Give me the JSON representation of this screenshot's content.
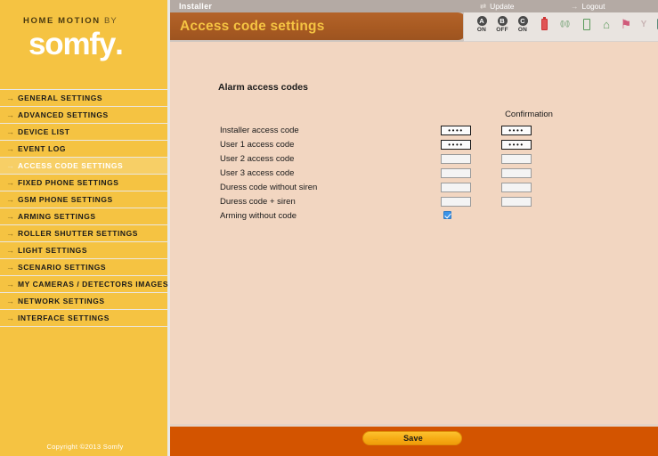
{
  "brand": {
    "tagline_main": "HOME MOTION",
    "tagline_by": "BY",
    "wordmark": "somfy",
    "wordmark_dot": ".",
    "copyright": "Copyright ©2013 Somfy"
  },
  "topbar": {
    "title": "Installer",
    "update_label": "Update",
    "update_icon": "refresh-icon",
    "logout_label": "Logout",
    "logout_icon": "arrow-right-icon"
  },
  "header": {
    "page_title": "Access code settings"
  },
  "status_icons": [
    {
      "name": "zone-a-indicator",
      "badge": "A",
      "label": "ON"
    },
    {
      "name": "zone-b-indicator",
      "badge": "B",
      "label": "OFF"
    },
    {
      "name": "zone-c-indicator",
      "badge": "C",
      "label": "ON"
    },
    {
      "name": "battery-icon"
    },
    {
      "name": "signal-waves-icon",
      "glyph": "))"
    },
    {
      "name": "door-sensor-icon"
    },
    {
      "name": "house-icon",
      "glyph": "⌂"
    },
    {
      "name": "flag-icon",
      "glyph": "⚑"
    },
    {
      "name": "antenna-icon",
      "glyph": "Y"
    },
    {
      "name": "module-icon"
    }
  ],
  "sidebar": {
    "items": [
      {
        "label": "GENERAL SETTINGS",
        "active": false
      },
      {
        "label": "ADVANCED SETTINGS",
        "active": false
      },
      {
        "label": "DEVICE LIST",
        "active": false
      },
      {
        "label": "EVENT LOG",
        "active": false
      },
      {
        "label": "ACCESS CODE SETTINGS",
        "active": true
      },
      {
        "label": "FIXED PHONE SETTINGS",
        "active": false
      },
      {
        "label": "GSM PHONE SETTINGS",
        "active": false
      },
      {
        "label": "ARMING SETTINGS",
        "active": false
      },
      {
        "label": "ROLLER SHUTTER SETTINGS",
        "active": false
      },
      {
        "label": "LIGHT SETTINGS",
        "active": false
      },
      {
        "label": "SCENARIO SETTINGS",
        "active": false
      },
      {
        "label": "MY CAMERAS / DETECTORS IMAGES",
        "active": false
      },
      {
        "label": "NETWORK SETTINGS",
        "active": false
      },
      {
        "label": "INTERFACE SETTINGS",
        "active": false
      }
    ]
  },
  "main": {
    "section_title": "Alarm access codes",
    "confirmation_header": "Confirmation",
    "rows": [
      {
        "label": "Installer access code",
        "type": "code",
        "value": "••••",
        "confirm": "••••",
        "filled": true
      },
      {
        "label": "User 1 access code",
        "type": "code",
        "value": "••••",
        "confirm": "••••",
        "filled": true
      },
      {
        "label": "User 2 access code",
        "type": "code",
        "value": "",
        "confirm": "",
        "filled": false
      },
      {
        "label": "User 3 access code",
        "type": "code",
        "value": "",
        "confirm": "",
        "filled": false
      },
      {
        "label": "Duress code without siren",
        "type": "code",
        "value": "",
        "confirm": "",
        "filled": false
      },
      {
        "label": "Duress code + siren",
        "type": "code",
        "value": "",
        "confirm": "",
        "filled": false
      },
      {
        "label": "Arming without code",
        "type": "checkbox",
        "checked": true
      }
    ]
  },
  "footer": {
    "save_label": "Save",
    "save_arrow": "→"
  },
  "colors": {
    "sidebar": "#f5c342",
    "title_bar": "#a85a22",
    "title_text": "#f5c342",
    "content_bg": "#f2d6c1",
    "footer": "#d35400",
    "topbar": "#b4aaa4",
    "save_button": "#f7ad16",
    "checkbox_checked": "#3c94e8"
  }
}
